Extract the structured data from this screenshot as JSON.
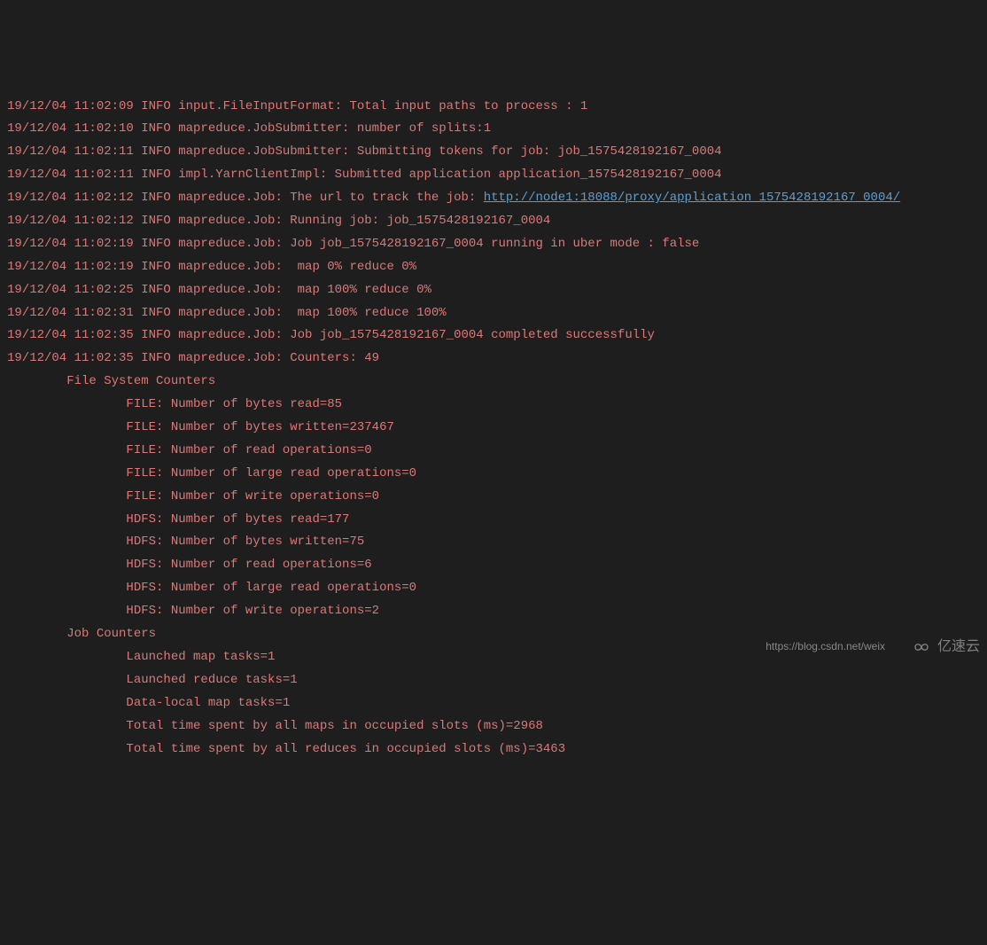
{
  "log": {
    "lines": [
      {
        "prefix": "19/12/04 11:02:09 INFO input.FileInputFormat: Total input paths to process : 1",
        "link": null
      },
      {
        "prefix": "19/12/04 11:02:10 INFO mapreduce.JobSubmitter: number of splits:1",
        "link": null
      },
      {
        "prefix": "19/12/04 11:02:11 INFO mapreduce.JobSubmitter: Submitting tokens for job: job_1575428192167_0004",
        "link": null
      },
      {
        "prefix": "19/12/04 11:02:11 INFO impl.YarnClientImpl: Submitted application application_1575428192167_0004",
        "link": null
      },
      {
        "prefix": "19/12/04 11:02:12 INFO mapreduce.Job: The url to track the job: ",
        "link": "http://node1:18088/proxy/application_1575428192167_0004/"
      },
      {
        "prefix": "19/12/04 11:02:12 INFO mapreduce.Job: Running job: job_1575428192167_0004",
        "link": null
      },
      {
        "prefix": "19/12/04 11:02:19 INFO mapreduce.Job: Job job_1575428192167_0004 running in uber mode : false",
        "link": null
      },
      {
        "prefix": "19/12/04 11:02:19 INFO mapreduce.Job:  map 0% reduce 0%",
        "link": null
      },
      {
        "prefix": "19/12/04 11:02:25 INFO mapreduce.Job:  map 100% reduce 0%",
        "link": null
      },
      {
        "prefix": "19/12/04 11:02:31 INFO mapreduce.Job:  map 100% reduce 100%",
        "link": null
      },
      {
        "prefix": "19/12/04 11:02:35 INFO mapreduce.Job: Job job_1575428192167_0004 completed successfully",
        "link": null
      },
      {
        "prefix": "19/12/04 11:02:35 INFO mapreduce.Job: Counters: 49",
        "link": null
      },
      {
        "prefix": "        File System Counters",
        "link": null
      },
      {
        "prefix": "                FILE: Number of bytes read=85",
        "link": null
      },
      {
        "prefix": "                FILE: Number of bytes written=237467",
        "link": null
      },
      {
        "prefix": "                FILE: Number of read operations=0",
        "link": null
      },
      {
        "prefix": "                FILE: Number of large read operations=0",
        "link": null
      },
      {
        "prefix": "                FILE: Number of write operations=0",
        "link": null
      },
      {
        "prefix": "                HDFS: Number of bytes read=177",
        "link": null
      },
      {
        "prefix": "                HDFS: Number of bytes written=75",
        "link": null
      },
      {
        "prefix": "                HDFS: Number of read operations=6",
        "link": null
      },
      {
        "prefix": "                HDFS: Number of large read operations=0",
        "link": null
      },
      {
        "prefix": "                HDFS: Number of write operations=2",
        "link": null
      },
      {
        "prefix": "        Job Counters ",
        "link": null
      },
      {
        "prefix": "                Launched map tasks=1",
        "link": null
      },
      {
        "prefix": "                Launched reduce tasks=1",
        "link": null
      },
      {
        "prefix": "                Data-local map tasks=1",
        "link": null
      },
      {
        "prefix": "                Total time spent by all maps in occupied slots (ms)=2968",
        "link": null
      },
      {
        "prefix": "                Total time spent by all reduces in occupied slots (ms)=3463",
        "link": null
      }
    ]
  },
  "watermark": {
    "url": "https://blog.csdn.net/weix",
    "logo_text": "亿速云"
  }
}
